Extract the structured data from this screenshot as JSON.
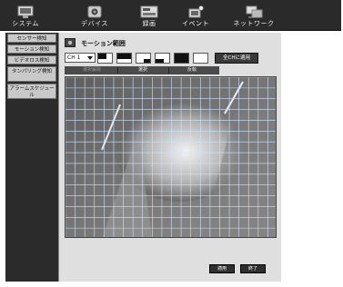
{
  "nav": {
    "tabs": [
      {
        "label": "システム",
        "icon": "monitor-icon"
      },
      {
        "label": "デバイス",
        "icon": "camera-icon"
      },
      {
        "label": "録画",
        "icon": "recorder-icon"
      },
      {
        "label": "イベント",
        "icon": "alarm-icon"
      },
      {
        "label": "ネットワーク",
        "icon": "network-icon"
      }
    ],
    "active": "イベント"
  },
  "sidebar": {
    "items": [
      {
        "label": "センサー検知"
      },
      {
        "label": "モーション検知"
      },
      {
        "label": "ビデオロス検知"
      },
      {
        "label": "タンパリング検知"
      },
      {
        "label": "アラームスケジュール"
      }
    ],
    "active": "モーション検知"
  },
  "main": {
    "title": "モーション範囲",
    "channel": "CH 1",
    "apply_all": "全CHに適用",
    "selection": {
      "clear": "選択解除",
      "select": "選択",
      "invert": "反転"
    },
    "buttons": {
      "apply": "適用",
      "close": "終了"
    }
  },
  "colors": {
    "nav_bg": "#2a2a2a",
    "sidebar_bg": "#2b2b2b",
    "panel_bg": "#dfdfdf",
    "grid_line": "#cfe3ff"
  }
}
